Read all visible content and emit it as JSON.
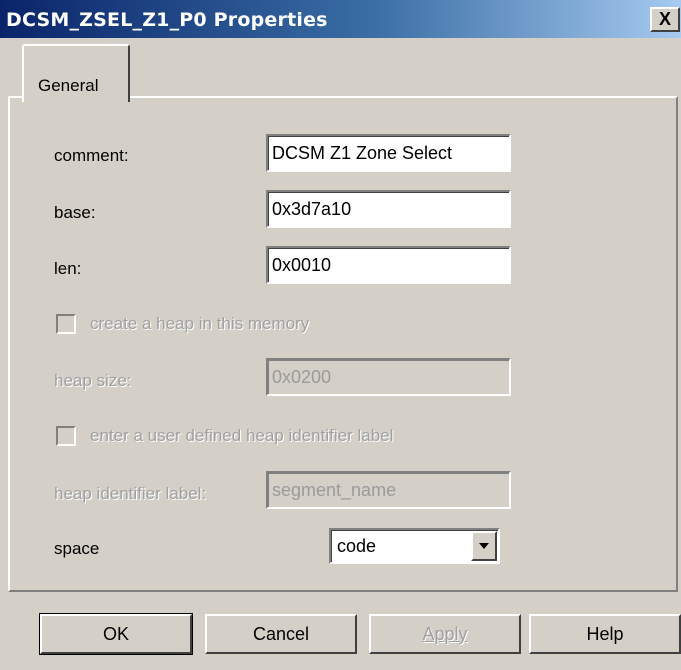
{
  "window": {
    "title": "DCSM_ZSEL_Z1_P0 Properties",
    "close_label": "X"
  },
  "tabs": [
    {
      "label": "General",
      "selected": true
    }
  ],
  "fields": {
    "comment": {
      "label": "comment:",
      "value": "DCSM Z1 Zone Select"
    },
    "base": {
      "label": "base:",
      "value": "0x3d7a10"
    },
    "len": {
      "label": "len:",
      "value": "0x0010"
    },
    "create_heap": {
      "label": "create a heap in this memory",
      "checked": false,
      "enabled": false
    },
    "heap_size": {
      "label": "heap size:",
      "value": "0x0200",
      "enabled": false
    },
    "user_heap_label": {
      "label": "enter a user defined heap identifier label",
      "checked": false,
      "enabled": false
    },
    "heap_identifier": {
      "label": "heap identifier label:",
      "value": "segment_name",
      "enabled": false
    },
    "space": {
      "label": "space",
      "value": "code"
    }
  },
  "buttons": {
    "ok": "OK",
    "cancel": "Cancel",
    "apply": "Apply",
    "help": "Help"
  },
  "colors": {
    "title_bar_start": "#0a246a",
    "title_bar_end": "#a6caf0",
    "face": "#d4d0c8"
  }
}
